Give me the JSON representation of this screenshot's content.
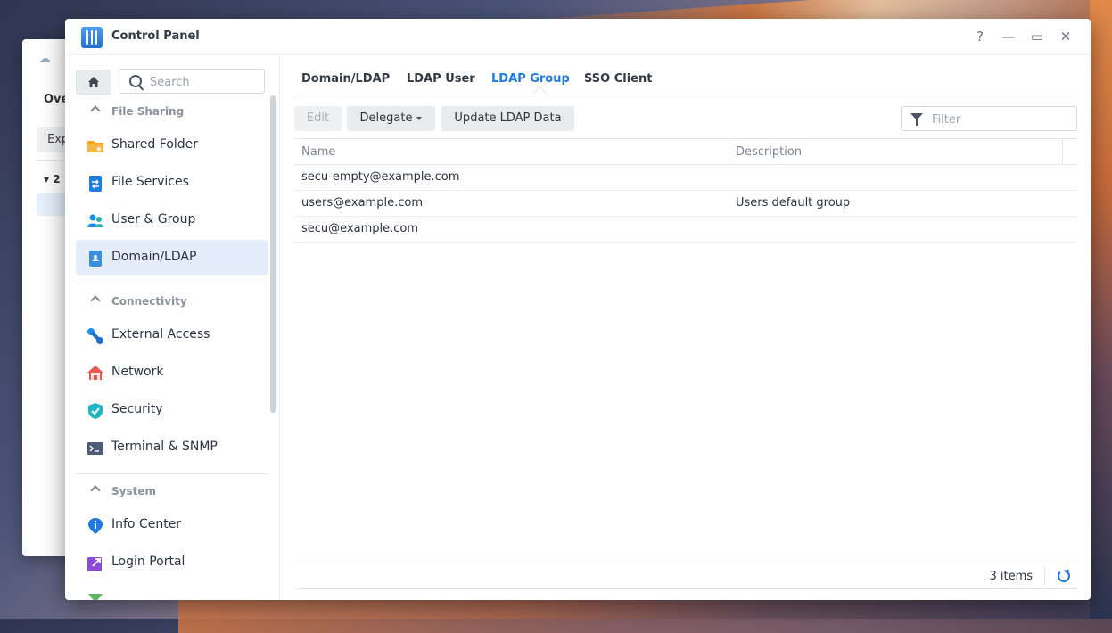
{
  "window": {
    "title": "Control Panel"
  },
  "background_window": {
    "tab": "Ove",
    "button": "Exp",
    "tree_label": "2"
  },
  "sidebar": {
    "search_placeholder": "Search",
    "sections": [
      {
        "label": "File Sharing",
        "items": [
          {
            "label": "Shared Folder",
            "icon": "folder-icon"
          },
          {
            "label": "File Services",
            "icon": "file-services-icon"
          },
          {
            "label": "User & Group",
            "icon": "users-icon"
          },
          {
            "label": "Domain/LDAP",
            "icon": "domain-icon",
            "active": true
          }
        ]
      },
      {
        "label": "Connectivity",
        "items": [
          {
            "label": "External Access",
            "icon": "external-access-icon"
          },
          {
            "label": "Network",
            "icon": "house-icon"
          },
          {
            "label": "Security",
            "icon": "shield-icon"
          },
          {
            "label": "Terminal & SNMP",
            "icon": "terminal-icon"
          }
        ]
      },
      {
        "label": "System",
        "items": [
          {
            "label": "Info Center",
            "icon": "info-icon"
          },
          {
            "label": "Login Portal",
            "icon": "login-portal-icon"
          }
        ]
      }
    ]
  },
  "tabs": [
    {
      "label": "Domain/LDAP"
    },
    {
      "label": "LDAP User"
    },
    {
      "label": "LDAP Group",
      "active": true
    },
    {
      "label": "SSO Client"
    }
  ],
  "toolbar": {
    "edit_label": "Edit",
    "delegate_label": "Delegate",
    "update_label": "Update LDAP Data",
    "filter_placeholder": "Filter"
  },
  "table": {
    "columns": [
      "Name",
      "Description"
    ],
    "rows": [
      {
        "name": "secu-empty@example.com",
        "description": ""
      },
      {
        "name": "users@example.com",
        "description": "Users default group"
      },
      {
        "name": "secu@example.com",
        "description": ""
      }
    ]
  },
  "footer": {
    "count_text": "3 items"
  },
  "colors": {
    "accent": "#1f7be0",
    "active_bg": "#e3eefa"
  }
}
